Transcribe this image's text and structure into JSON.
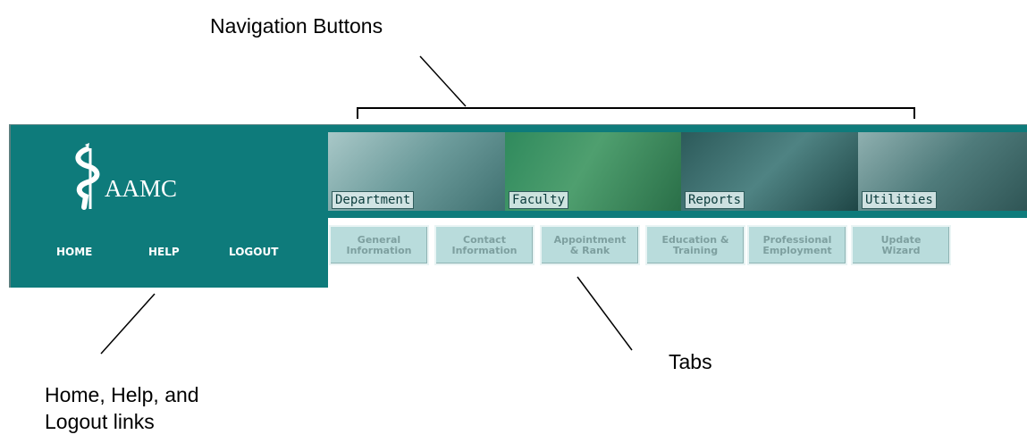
{
  "callouts": {
    "navigation": "Navigation Buttons",
    "tabs": "Tabs",
    "links_line1": "Home, Help, and",
    "links_line2": "Logout links"
  },
  "logo": {
    "text": "AAMC"
  },
  "links": [
    "HOME",
    "HELP",
    "LOGOUT"
  ],
  "nav_buttons": [
    "Department",
    "Faculty",
    "Reports",
    "Utilities"
  ],
  "tabs": [
    {
      "line1": "General",
      "line2": "Information"
    },
    {
      "line1": "Contact",
      "line2": "Information"
    },
    {
      "line1": "Appointment",
      "line2": "& Rank"
    },
    {
      "line1": "Education &",
      "line2": "Training"
    },
    {
      "line1": "Professional",
      "line2": "Employment"
    },
    {
      "line1": "Update",
      "line2": "Wizard"
    }
  ],
  "colors": {
    "banner": "#0e7b7b",
    "tab_bg": "#b9dcdc",
    "tab_text": "#7d9f9f"
  }
}
